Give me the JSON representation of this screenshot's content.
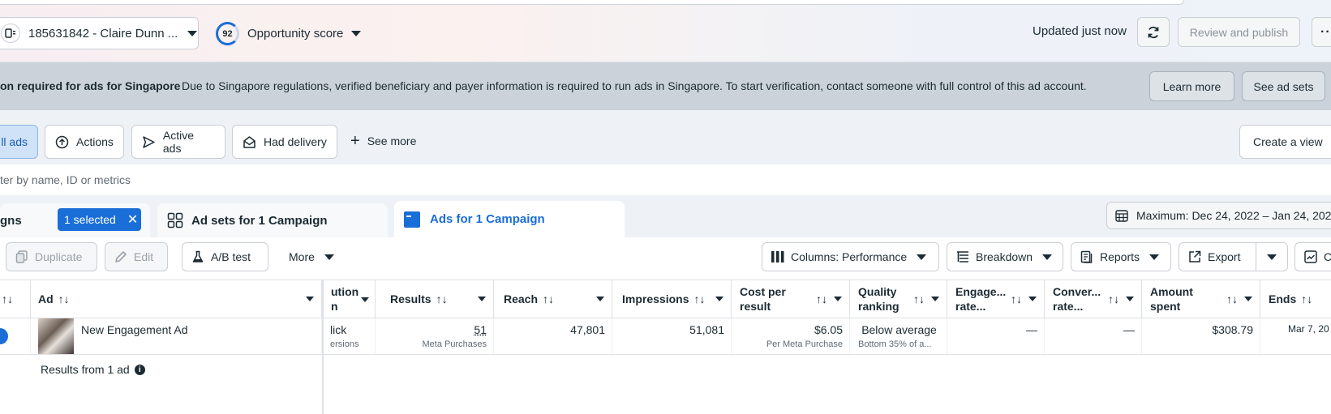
{
  "topbar": {
    "account_label": "185631842 - Claire Dunn ...",
    "opportunity_score": "92",
    "opportunity_label": "Opportunity score",
    "updated_text": "Updated just now",
    "review_publish_label": "Review and publish",
    "more_label": "···"
  },
  "banner": {
    "title": "on required for ads for Singapore",
    "message": "Due to Singapore regulations, verified beneficiary and payer information is required to run ads in Singapore. To start verification, contact someone with full control of this ad account.",
    "learn_more_label": "Learn more",
    "see_ad_sets_label": "See ad sets"
  },
  "filters": {
    "all_ads_label": "ll ads",
    "actions_label": "Actions",
    "active_ads_label": "Active ads",
    "had_delivery_label": "Had delivery",
    "see_more_label": "See more",
    "create_view_label": "Create a view"
  },
  "search": {
    "placeholder": "ter by name, ID or metrics"
  },
  "tabs": {
    "campaigns_label": "gns",
    "selected_label": "1 selected",
    "adsets_label": "Ad sets for 1 Campaign",
    "ads_label": "Ads for 1 Campaign",
    "date_range": "Maximum: Dec 24, 2022 – Jan 24, 2023"
  },
  "toolbar": {
    "duplicate_label": "Duplicate",
    "edit_label": "Edit",
    "ab_test_label": "A/B test",
    "more_label": "More",
    "columns_label": "Columns: Performance",
    "breakdown_label": "Breakdown",
    "reports_label": "Reports",
    "export_label": "Export",
    "chart_label": "C"
  },
  "table": {
    "headers": {
      "ad": "Ad",
      "attribution_line1": "ution",
      "attribution_line2": "n",
      "results": "Results",
      "reach": "Reach",
      "impressions": "Impressions",
      "cost_line1": "Cost per",
      "cost_line2": "result",
      "quality_line1": "Quality",
      "quality_line2": "ranking",
      "engage_line1": "Engage...",
      "engage_line2": "rate...",
      "conver_line1": "Conver...",
      "conver_line2": "rate...",
      "amount_line1": "Amount",
      "amount_line2": "spent",
      "ends": "Ends"
    },
    "row": {
      "ad_name": "New Engagement Ad",
      "attribution_main": "lick",
      "attribution_sub": "ersions",
      "results_value": "51",
      "results_sub": "Meta Purchases",
      "reach": "47,801",
      "impressions": "51,081",
      "cost": "$6.05",
      "cost_sub": "Per Meta Purchase",
      "quality": "Below average",
      "quality_sub": "Bottom 35% of a...",
      "engage": "—",
      "conver": "—",
      "amount": "$308.79",
      "ends": "Mar 7, 20"
    },
    "totals_label": "Results from 1 ad"
  },
  "colors": {
    "accent": "#1a6ed8",
    "banner_bg": "#cbd2d9",
    "status_active": "#1a6ed8"
  }
}
